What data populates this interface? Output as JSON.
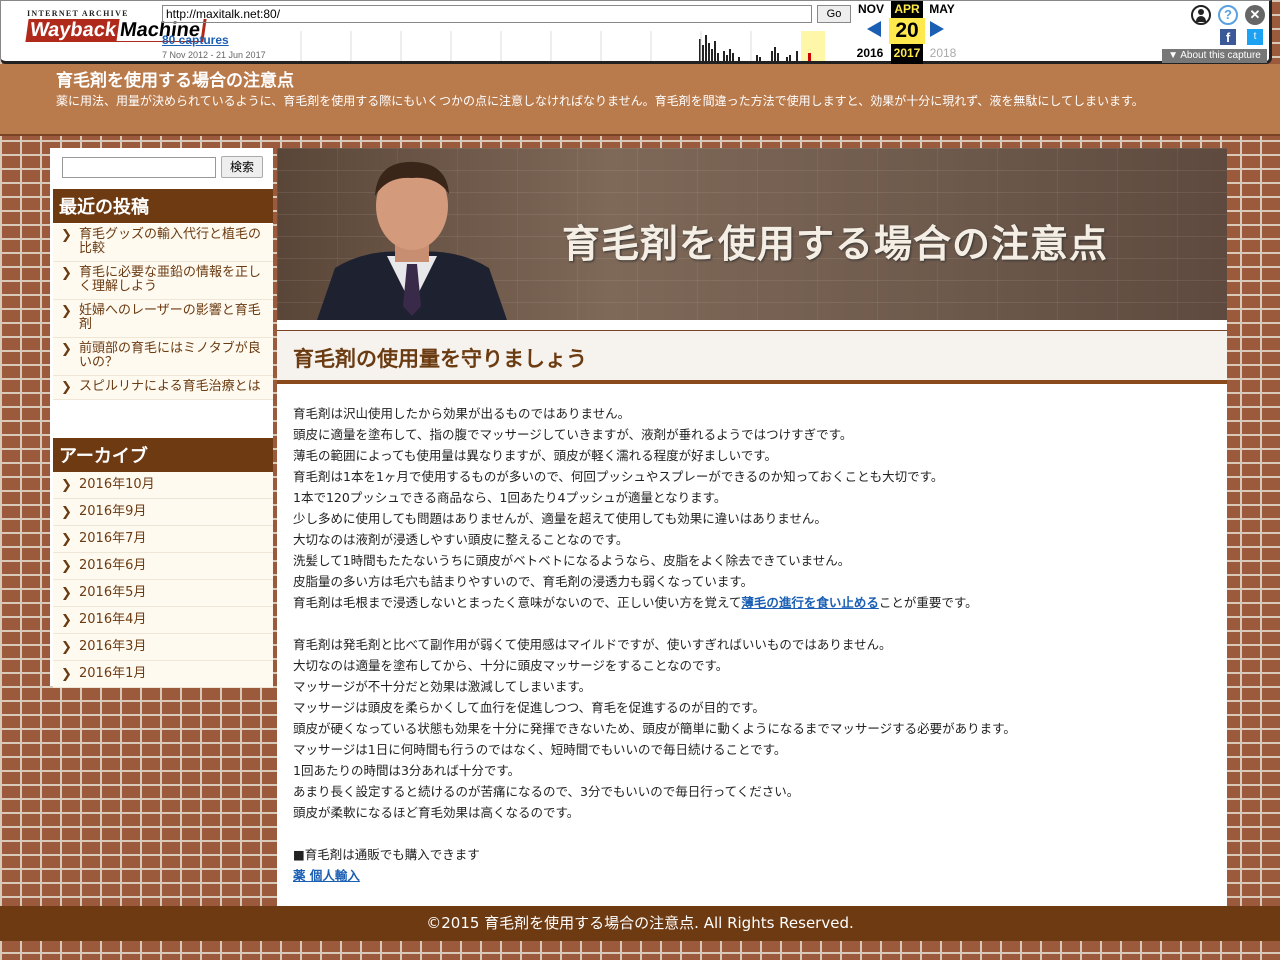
{
  "wayback": {
    "logo_small": "INTERNET ARCHIVE",
    "logo_main": "Wayback",
    "logo_main2": "Machine",
    "url": "http://maxitalk.net:80/",
    "go_label": "Go",
    "captures": "80 captures",
    "range": "7 Nov 2012 - 21 Jun 2017",
    "prev_month": "NOV",
    "cur_month": "APR",
    "next_month": "MAY",
    "cur_day": "20",
    "prev_year": "2016",
    "cur_year": "2017",
    "next_year": "2018",
    "about": "About this capture",
    "colors": {
      "accent_yellow": "#ffe94d",
      "nav_blue": "#1a5fb4"
    }
  },
  "header": {
    "title": "育毛剤を使用する場合の注意点",
    "description": "薬に用法、用量が決められているように、育毛剤を使用する際にもいくつかの点に注意しなければなりません。育毛剤を間違った方法で使用しますと、効果が十分に現れず、液を無駄にしてしまいます。"
  },
  "sidebar": {
    "search_button": "検索",
    "recent_title": "最近の投稿",
    "recent_posts": [
      "育毛グッズの輸入代行と植毛の比較",
      "育毛に必要な亜鉛の情報を正しく理解しよう",
      "妊婦へのレーザーの影響と育毛剤",
      "前頭部の育毛にはミノタブが良いの？",
      "スピルリナによる育毛治療とは"
    ],
    "archive_title": "アーカイブ",
    "archives": [
      "2016年10月",
      "2016年9月",
      "2016年7月",
      "2016年6月",
      "2016年5月",
      "2016年4月",
      "2016年3月",
      "2016年1月"
    ]
  },
  "hero": {
    "title": "育毛剤を使用する場合の注意点"
  },
  "article": {
    "title": "育毛剤の使用量を守りましょう",
    "para1": [
      "育毛剤は沢山使用したから効果が出るものではありません。",
      "頭皮に適量を塗布して、指の腹でマッサージしていきますが、液剤が垂れるようではつけすぎです。",
      "薄毛の範囲によっても使用量は異なりますが、頭皮が軽く濡れる程度が好ましいです。",
      "育毛剤は1本を1ヶ月で使用するものが多いので、何回プッシュやスプレーができるのか知っておくことも大切です。",
      "1本で120プッシュできる商品なら、1回あたり4プッシュが適量となります。",
      "少し多めに使用しても問題はありませんが、適量を超えて使用しても効果に違いはありません。",
      "大切なのは液剤が浸透しやすい頭皮に整えることなのです。",
      "洗髪して1時間もたたないうちに頭皮がベトベトになるようなら、皮脂をよく除去できていません。",
      "皮脂量の多い方は毛穴も詰まりやすいので、育毛剤の浸透力も弱くなっています。"
    ],
    "para1_last_before": "育毛剤は毛根まで浸透しないとまったく意味がないので、正しい使い方を覚えて",
    "para1_link": "薄毛の進行を食い止める",
    "para1_last_after": "ことが重要です。",
    "para2": [
      "育毛剤は発毛剤と比べて副作用が弱くて使用感はマイルドですが、使いすぎればいいものではありません。",
      "大切なのは適量を塗布してから、十分に頭皮マッサージをすることなのです。",
      "マッサージが不十分だと効果は激減してしまいます。",
      "マッサージは頭皮を柔らかくして血行を促進しつつ、育毛を促進するのが目的です。",
      "頭皮が硬くなっている状態も効果を十分に発揮できないため、頭皮が簡単に動くようになるまでマッサージする必要があります。",
      "マッサージは1日に何時間も行うのではなく、短時間でもいいので毎日続けることです。",
      "1回あたりの時間は3分あれば十分です。",
      "あまり長く設定すると続けるのが苦痛になるので、3分でもいいので毎日行ってください。",
      "頭皮が柔軟になるほど育毛効果は高くなるのです。"
    ],
    "note": "■育毛剤は通販でも購入できます",
    "note_link": "薬 個人輸入"
  },
  "footer": {
    "copyright": "©2015 育毛剤を使用する場合の注意点. All Rights Reserved."
  }
}
